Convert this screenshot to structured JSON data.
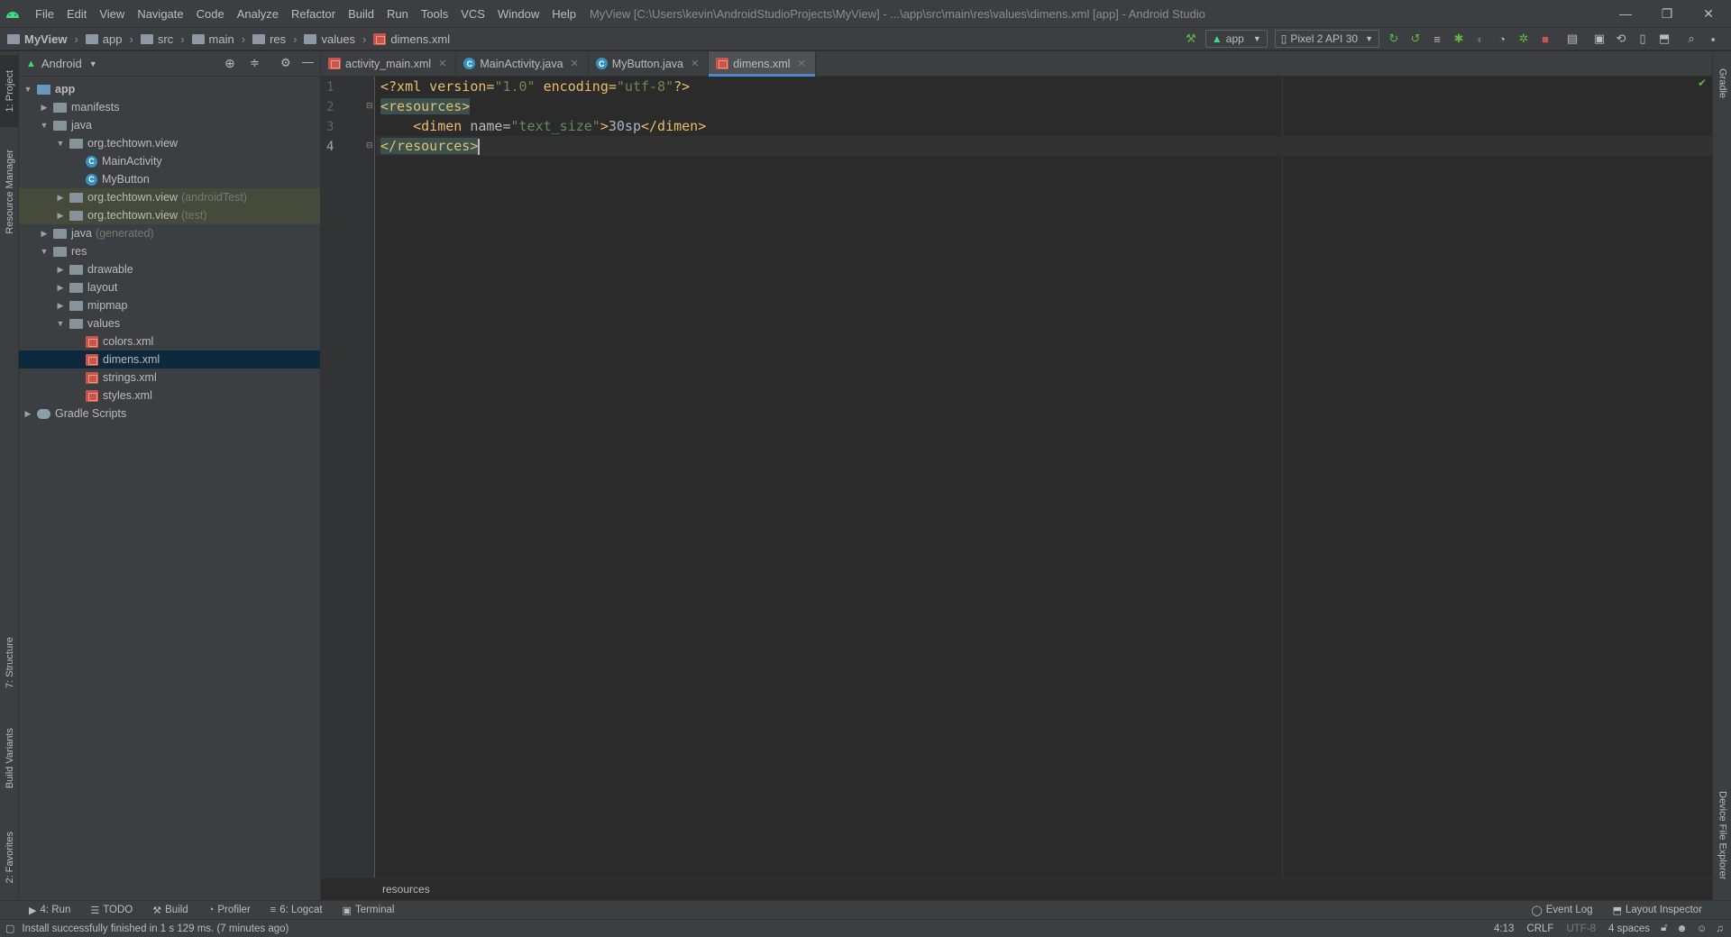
{
  "menubar": {
    "items": [
      "File",
      "Edit",
      "View",
      "Navigate",
      "Code",
      "Analyze",
      "Refactor",
      "Build",
      "Run",
      "Tools",
      "VCS",
      "Window",
      "Help"
    ],
    "title": "MyView [C:\\Users\\kevin\\AndroidStudioProjects\\MyView] - ...\\app\\src\\main\\res\\values\\dimens.xml [app] - Android Studio"
  },
  "breadcrumb": [
    "MyView",
    "app",
    "src",
    "main",
    "res",
    "values",
    "dimens.xml"
  ],
  "toolbar": {
    "run_config": "app",
    "device": "Pixel 2 API 30"
  },
  "project_panel": {
    "view_mode": "Android",
    "tree": [
      {
        "label": "app",
        "indent": 0,
        "expanded": true,
        "icon": "module-folder-icon",
        "bold": true
      },
      {
        "label": "manifests",
        "indent": 1,
        "expanded": false,
        "icon": "folder-icon"
      },
      {
        "label": "java",
        "indent": 1,
        "expanded": true,
        "icon": "folder-icon"
      },
      {
        "label": "org.techtown.view",
        "indent": 2,
        "expanded": true,
        "icon": "package-icon"
      },
      {
        "label": "MainActivity",
        "indent": 3,
        "icon": "class-icon"
      },
      {
        "label": "MyButton",
        "indent": 3,
        "icon": "class-icon"
      },
      {
        "label": "org.techtown.view",
        "suffix": "(androidTest)",
        "indent": 2,
        "expanded": false,
        "icon": "package-icon",
        "tinted": true
      },
      {
        "label": "org.techtown.view",
        "suffix": "(test)",
        "indent": 2,
        "expanded": false,
        "icon": "package-icon",
        "tinted": true
      },
      {
        "label": "java",
        "suffix": "(generated)",
        "indent": 1,
        "expanded": false,
        "icon": "folder-icon"
      },
      {
        "label": "res",
        "indent": 1,
        "expanded": true,
        "icon": "folder-icon"
      },
      {
        "label": "drawable",
        "indent": 2,
        "expanded": false,
        "icon": "folder-icon"
      },
      {
        "label": "layout",
        "indent": 2,
        "expanded": false,
        "icon": "folder-icon"
      },
      {
        "label": "mipmap",
        "indent": 2,
        "expanded": false,
        "icon": "folder-icon"
      },
      {
        "label": "values",
        "indent": 2,
        "expanded": true,
        "icon": "folder-icon"
      },
      {
        "label": "colors.xml",
        "indent": 3,
        "icon": "xml-file-icon"
      },
      {
        "label": "dimens.xml",
        "indent": 3,
        "icon": "xml-file-icon",
        "selected": true
      },
      {
        "label": "strings.xml",
        "indent": 3,
        "icon": "xml-file-icon"
      },
      {
        "label": "styles.xml",
        "indent": 3,
        "icon": "xml-file-icon"
      },
      {
        "label": "Gradle Scripts",
        "indent": 0,
        "expanded": false,
        "icon": "gradle-icon"
      }
    ]
  },
  "tabs": [
    {
      "label": "activity_main.xml",
      "icon": "xml-file-icon"
    },
    {
      "label": "MainActivity.java",
      "icon": "class-icon"
    },
    {
      "label": "MyButton.java",
      "icon": "class-icon"
    },
    {
      "label": "dimens.xml",
      "icon": "xml-file-icon",
      "active": true
    }
  ],
  "editor": {
    "line_numbers": [
      "1",
      "2",
      "3",
      "4"
    ],
    "line1": {
      "a": "<?xml version=",
      "b": "\"1.0\"",
      "c": " encoding=",
      "d": "\"utf-8\"",
      "e": "?>"
    },
    "line2": "<resources>",
    "line3": {
      "a": "<dimen ",
      "b": "name=",
      "c": "\"text_size\"",
      "d": ">",
      "e": "30sp",
      "f": "</dimen>"
    },
    "line4": "</resources>",
    "breadcrumb": "resources"
  },
  "left_strip": {
    "project": "1: Project",
    "resource_manager": "Resource Manager",
    "structure": "7: Structure",
    "build_variants": "Build Variants",
    "favorites": "2: Favorites"
  },
  "right_strip": {
    "gradle": "Gradle",
    "device_file_explorer": "Device File Explorer"
  },
  "bottom_tools": {
    "run": "4: Run",
    "todo": "TODO",
    "build": "Build",
    "profiler": "Profiler",
    "logcat": "6: Logcat",
    "terminal": "Terminal",
    "event_log": "Event Log",
    "layout_inspector": "Layout Inspector"
  },
  "status": {
    "message": "Install successfully finished in 1 s 129 ms. (7 minutes ago)",
    "position": "4:13",
    "line_sep": "CRLF",
    "encoding": "UTF-8",
    "indent": "4 spaces"
  },
  "colors": {
    "accent": "#4a88c7",
    "android_green": "#3ddc84",
    "xml_tag": "#e8bf6a",
    "string": "#6a8759"
  }
}
